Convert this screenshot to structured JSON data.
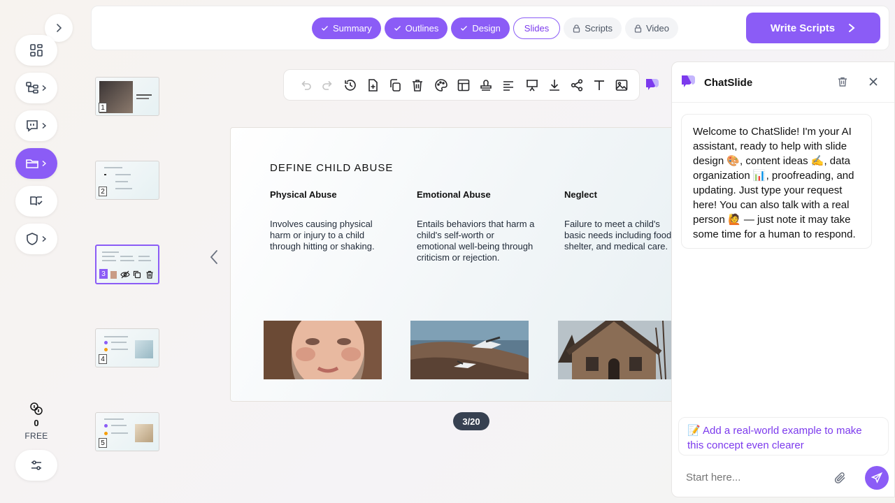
{
  "colors": {
    "accent": "#8b5cf6",
    "accent_dark": "#7c3aed"
  },
  "steps": [
    {
      "label": "Summary",
      "state": "done"
    },
    {
      "label": "Outlines",
      "state": "done"
    },
    {
      "label": "Design",
      "state": "done"
    },
    {
      "label": "Slides",
      "state": "current"
    },
    {
      "label": "Scripts",
      "state": "locked"
    },
    {
      "label": "Video",
      "state": "locked"
    }
  ],
  "write_button": {
    "label": "Write Scripts"
  },
  "sidebar": {
    "items": [
      {
        "icon": "dashboard-icon"
      },
      {
        "icon": "workflow-icon"
      },
      {
        "icon": "feedback-icon"
      },
      {
        "icon": "folder-icon",
        "active": true
      },
      {
        "icon": "book-icon"
      },
      {
        "icon": "shield-icon"
      }
    ],
    "credits": {
      "value": "0",
      "plan": "FREE"
    }
  },
  "thumbnails": [
    "1",
    "2",
    "3",
    "4",
    "5"
  ],
  "slide": {
    "title": "DEFINE CHILD ABUSE",
    "columns": [
      {
        "heading": "Physical Abuse",
        "body": "Involves causing physical harm or injury to a child through hitting or shaking."
      },
      {
        "heading": "Emotional Abuse",
        "body": "Entails behaviors that harm a child's self-worth or emotional well-being through criticism or rejection."
      },
      {
        "heading": "Neglect",
        "body": "Failure to meet a child's basic needs including food, shelter, and medical care."
      }
    ],
    "page_indicator": "3/20"
  },
  "chat": {
    "title": "ChatSlide",
    "welcome": "Welcome to ChatSlide! I'm your AI assistant, ready to help with slide design 🎨, content ideas ✍️, data organization 📊, proofreading, and updating. Just type your request here! You can also talk with a real person 🙋 — just note it may take some time for a human to respond.",
    "suggestion": "📝 Add a real-world example to make this concept even clearer",
    "input_placeholder": "Start here..."
  }
}
